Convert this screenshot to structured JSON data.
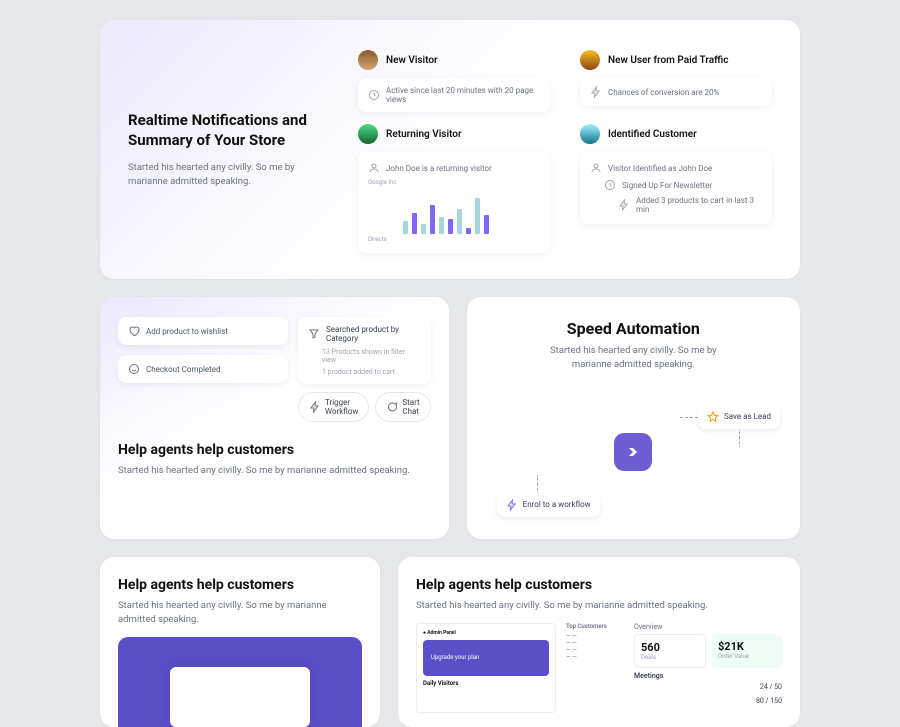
{
  "hero": {
    "title": "Realtime Notifications and Summary of Your Store",
    "subtitle": "Started his hearted any civilly. So me by marianne admitted speaking.",
    "cols": [
      {
        "title": "New Visitor",
        "info": "Active since last 20 minutes with 20 page views"
      },
      {
        "title": "New User from Paid Traffic",
        "info": "Chances of conversion are 20%"
      },
      {
        "title": "Returning Visitor",
        "info": "John Doe is a returning visitor",
        "labels": {
          "a": "Google Inc",
          "b": "Directs"
        }
      },
      {
        "title": "Identified Customer",
        "rows": [
          "Visitor Identified as John Doe",
          "Signed Up For Newsletter",
          "Added 3 products to cart in last 3 min"
        ]
      }
    ]
  },
  "agents": {
    "title": "Help agents help customers",
    "subtitle": "Started his hearted any civilly. So me by marianne admitted speaking.",
    "chip_wishlist": "Add product to wishlist",
    "chip_checkout": "Checkout Completed",
    "search": "Searched product by Category",
    "search_sub1": "13 Products shown in filter view",
    "search_sub2": "1 product added to cart",
    "btn_trigger": "Trigger Workflow",
    "btn_chat": "Start Chat"
  },
  "speed": {
    "title": "Speed Automation",
    "subtitle": "Started his hearted any civilly. So me by marianne admitted speaking.",
    "chip_save": "Save as Lead",
    "chip_enrol": "Enrol to a workflow"
  },
  "bottom": {
    "title": "Help agents help customers",
    "subtitle": "Started his hearted any civilly. So me by marianne admitted speaking."
  },
  "dashboard": {
    "banner": "Upgrade your plan",
    "daily": "Daily Visitors",
    "topc": "Top Customers",
    "overview": "Overview",
    "stat1_val": "560",
    "stat1_lbl": "Deals",
    "stat2_val": "$21K",
    "stat2_lbl": "Order Value",
    "meetings": "Meetings",
    "m1_a": "",
    "m1_b": "24 / 50",
    "m2_a": "",
    "m2_b": "80 / 150"
  },
  "chart_data": {
    "type": "bar",
    "categories": [
      "",
      "",
      "",
      "",
      "",
      "",
      "",
      "",
      "",
      ""
    ],
    "values": [
      12,
      20,
      10,
      28,
      16,
      14,
      24,
      6,
      34,
      18
    ],
    "series_colors": [
      "#a5d8dd",
      "#7c69ef"
    ],
    "ylim": [
      0,
      40
    ]
  }
}
